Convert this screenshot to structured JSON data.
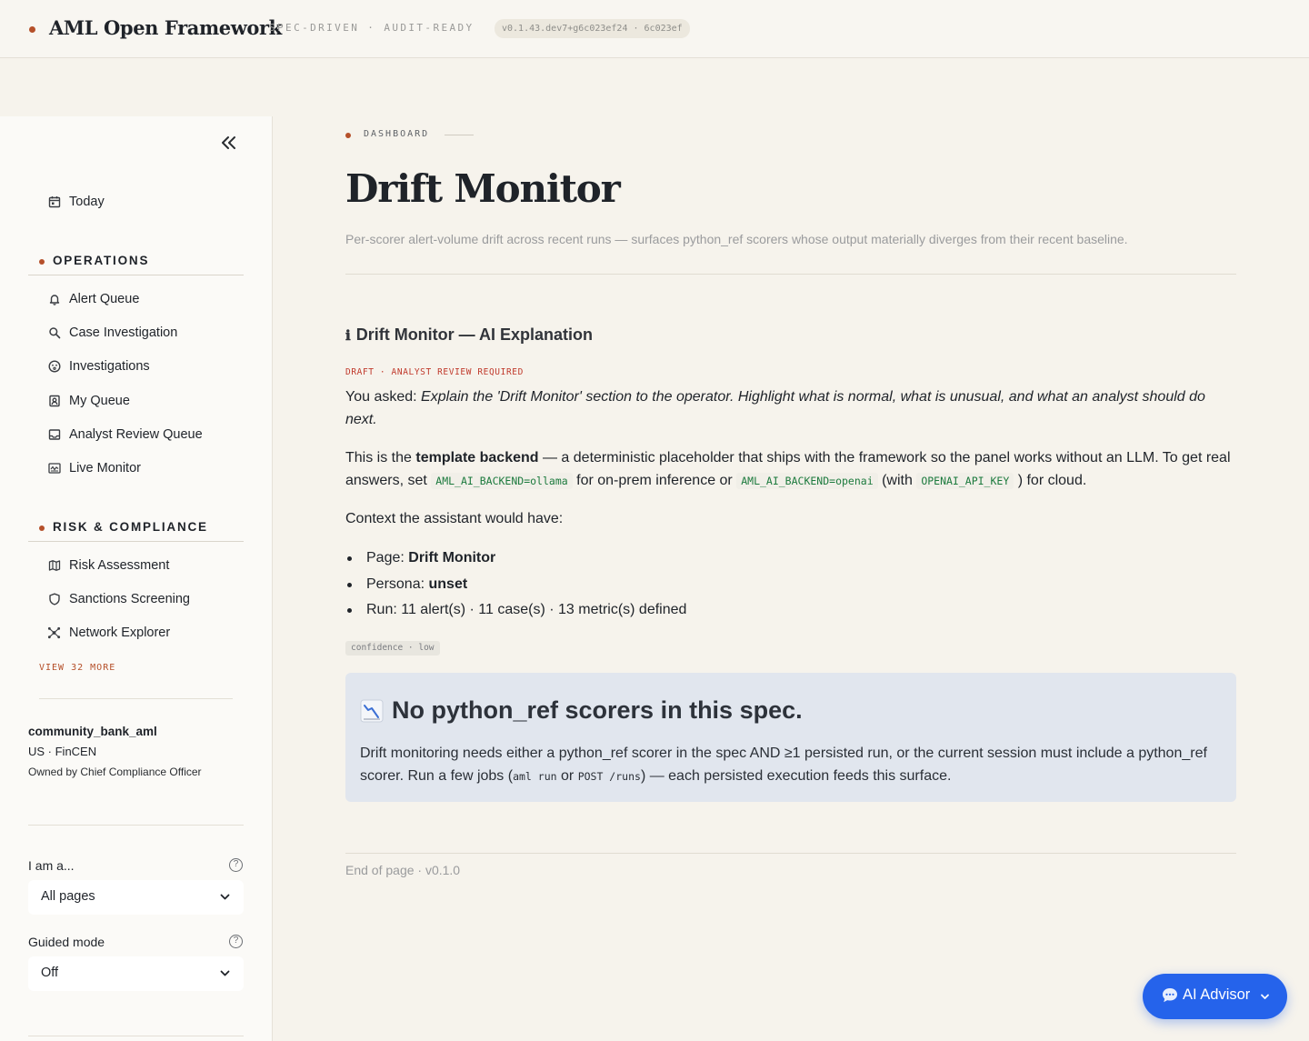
{
  "header": {
    "brand": "AML Open Framework",
    "tagline": "SPEC-DRIVEN · AUDIT-READY",
    "version": "v0.1.43.dev7+g6c023ef24 · 6c023ef"
  },
  "sidebar": {
    "top_item": {
      "label": "Today",
      "icon": "calendar-icon"
    },
    "sections": [
      {
        "title": "OPERATIONS",
        "items": [
          {
            "label": "Alert Queue",
            "icon": "bell-icon"
          },
          {
            "label": "Case Investigation",
            "icon": "search-icon"
          },
          {
            "label": "Investigations",
            "icon": "face-icon"
          },
          {
            "label": "My Queue",
            "icon": "user-badge-icon"
          },
          {
            "label": "Analyst Review Queue",
            "icon": "inbox-icon"
          },
          {
            "label": "Live Monitor",
            "icon": "monitor-icon"
          }
        ]
      },
      {
        "title": "RISK & COMPLIANCE",
        "items": [
          {
            "label": "Risk Assessment",
            "icon": "map-icon"
          },
          {
            "label": "Sanctions Screening",
            "icon": "shield-icon"
          },
          {
            "label": "Network Explorer",
            "icon": "network-icon"
          }
        ]
      }
    ],
    "view_more": "VIEW 32 MORE",
    "workspace": {
      "name": "community_bank_aml",
      "region": "US · FinCEN",
      "owner": "Owned by Chief Compliance Officer"
    },
    "persona": {
      "label": "I am a...",
      "value": "All pages"
    },
    "guided": {
      "label": "Guided mode",
      "value": "Off"
    }
  },
  "main": {
    "breadcrumb": "DASHBOARD",
    "title": "Drift Monitor",
    "subtitle": "Per-scorer alert-volume drift across recent runs — surfaces python_ref scorers whose output materially diverges from their recent baseline.",
    "ai": {
      "title": "Drift Monitor — AI Explanation",
      "draft_tag": "DRAFT · ANALYST REVIEW REQUIRED",
      "asked_prefix": "You asked:",
      "asked_text": "Explain the 'Drift Monitor' section to the operator. Highlight what is normal, what is unusual, and what an analyst should do next.",
      "p2_a": "This is the",
      "p2_bold": "template backend",
      "p2_b": "— a deterministic placeholder that ships with the framework so the panel works without an LLM. To get real answers, set",
      "code1": "AML_AI_BACKEND=ollama",
      "p2_c": "for on-prem inference or",
      "code2": "AML_AI_BACKEND=openai",
      "p2_d": "(with",
      "code3": "OPENAI_API_KEY",
      "p2_e": ") for cloud.",
      "context_intro": "Context the assistant would have:",
      "page_label": "Page:",
      "page_value": "Drift Monitor",
      "persona_label": "Persona:",
      "persona_value": "unset",
      "run_text": "Run: 11 alert(s) · 11 case(s) · 13 metric(s) defined",
      "confidence": "confidence · low"
    },
    "notice": {
      "title": "No python_ref scorers in this spec.",
      "body_a": "Drift monitoring needs either a python_ref scorer in the spec AND ≥1 persisted run, or the current session must include a python_ref scorer. Run a few jobs (",
      "code_a": "aml run",
      "body_b": "or",
      "code_b": "POST /runs",
      "body_c": ") — each persisted execution feeds this surface."
    },
    "footer": "End of page · v0.1.0"
  },
  "advisor": {
    "label": "AI Advisor"
  },
  "colors": {
    "accent": "#b5502a",
    "advisor": "#2563eb",
    "code_green": "#1c7a3d",
    "draft_red": "#c0392b"
  }
}
